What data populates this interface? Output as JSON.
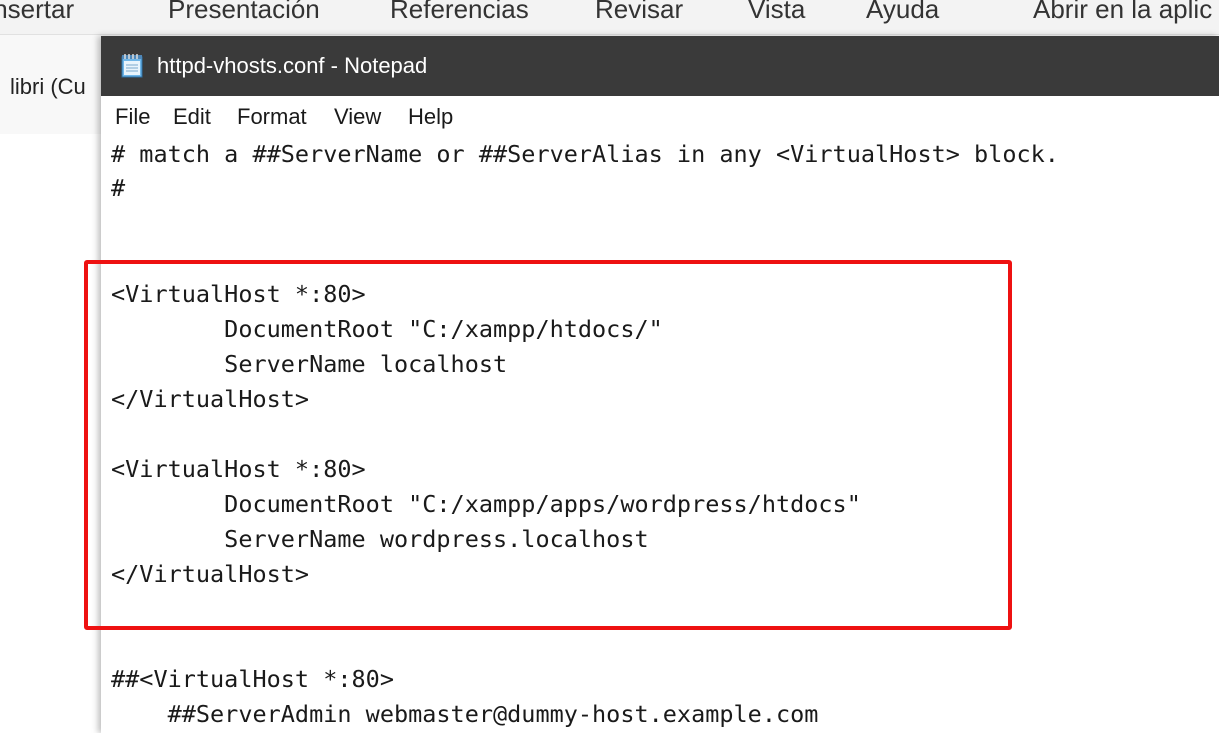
{
  "background_app": {
    "ribbon_tabs": [
      "Insertar",
      "Presentación",
      "Referencias",
      "Revisar",
      "Vista",
      "Ayuda",
      "Abrir en la aplic"
    ],
    "font_name": "libri (Cu"
  },
  "window": {
    "title": "httpd-vhosts.conf - Notepad",
    "icon": "notepad-icon"
  },
  "menu": {
    "items": [
      "File",
      "Edit",
      "Format",
      "View",
      "Help"
    ]
  },
  "editor": {
    "lines": [
      "# match a ##ServerName or ##ServerAlias in any <VirtualHost> block.",
      "#",
      "",
      "",
      "<VirtualHost *:80>",
      "        DocumentRoot \"C:/xampp/htdocs/\"",
      "        ServerName localhost",
      "</VirtualHost>",
      "",
      "<VirtualHost *:80>",
      "        DocumentRoot \"C:/xampp/apps/wordpress/htdocs\"",
      "        ServerName wordpress.localhost",
      "</VirtualHost>",
      "",
      "",
      "##<VirtualHost *:80>",
      "    ##ServerAdmin webmaster@dummy-host.example.com"
    ]
  },
  "annotation": {
    "highlight_color": "#ee1111"
  }
}
